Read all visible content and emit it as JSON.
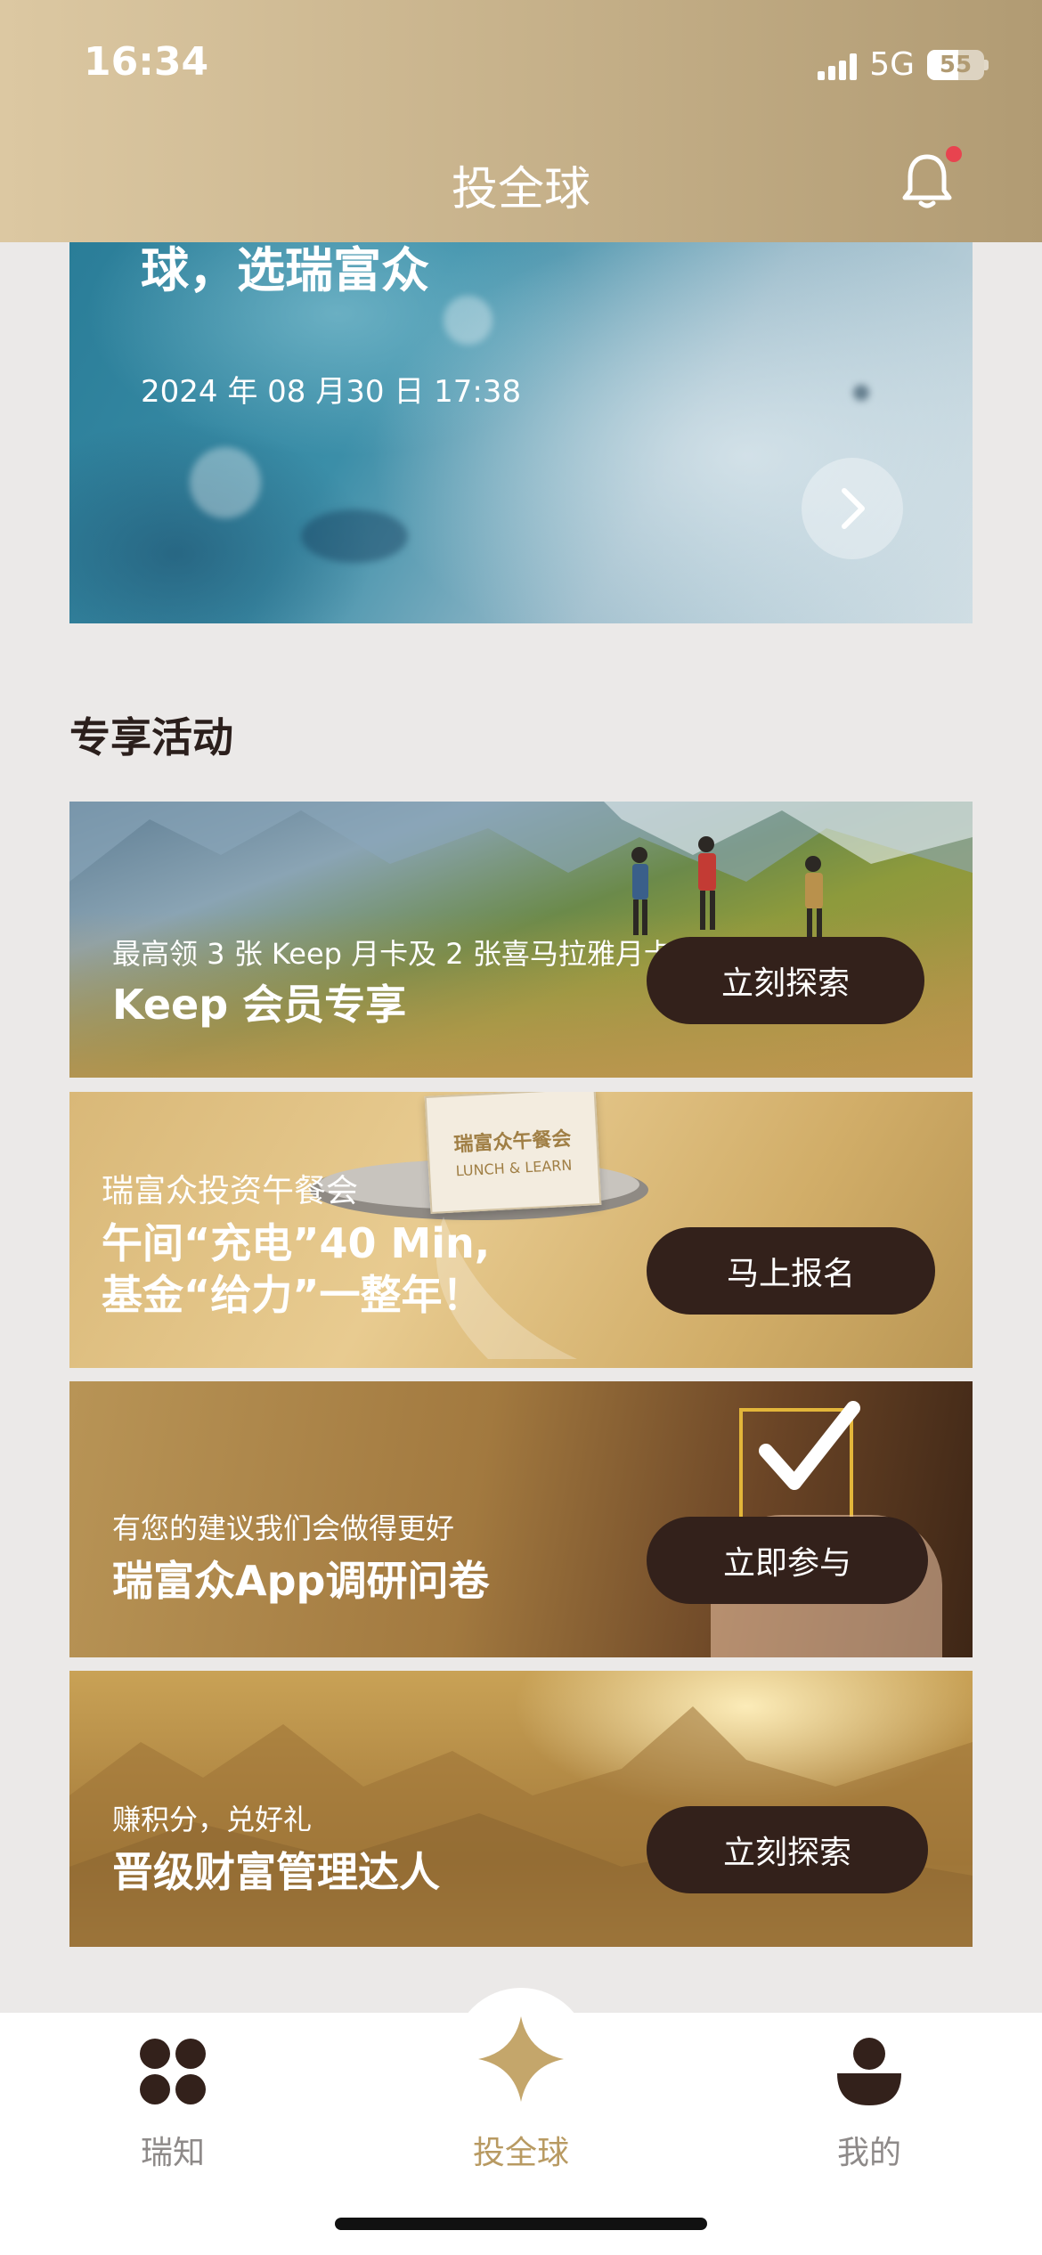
{
  "status_bar": {
    "time": "16:34",
    "network": "5G",
    "battery": "55"
  },
  "header": {
    "title": "投全球"
  },
  "hero": {
    "title": "球，选瑞富众",
    "date": "2024 年 08 月30 日 17:38"
  },
  "section": {
    "title": "专享活动"
  },
  "banners": [
    {
      "subtitle": "最高领 3 张 Keep 月卡及 2 张喜马拉雅月卡",
      "title": "Keep 会员专享",
      "button": "立刻探索"
    },
    {
      "subtitle": "瑞富众投资午餐会",
      "title_line1": "午间“充电”40 Min,",
      "title_line2": "基金“给力”一整年！",
      "button": "马上报名",
      "card_line1": "瑞富众午餐会",
      "card_line2": "LUNCH & LEARN"
    },
    {
      "subtitle": "有您的建议我们会做得更好",
      "title": "瑞富众App调研问卷",
      "button": "立即参与"
    },
    {
      "subtitle": "赚积分，兑好礼",
      "title": "晋级财富管理达人",
      "button": "立刻探索"
    }
  ],
  "tabs": [
    {
      "label": "瑞知",
      "icon": "grid-icon"
    },
    {
      "label": "投全球",
      "icon": "star-icon",
      "active": true
    },
    {
      "label": "我的",
      "icon": "profile-icon"
    }
  ],
  "colors": {
    "accent": "#b89a62",
    "button_bg": "#33211b",
    "bell_dot": "#e8434f"
  }
}
